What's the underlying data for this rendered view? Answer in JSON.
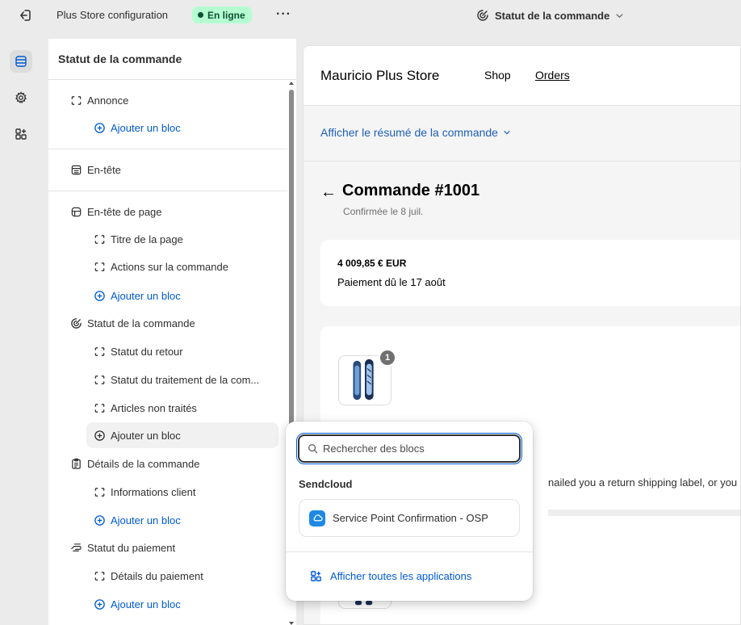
{
  "topbar": {
    "store_title": "Plus Store configuration",
    "status_label": "En ligne",
    "more_label": "···",
    "page_select_label": "Statut de la commande"
  },
  "sidebar": {
    "title": "Statut de la commande",
    "rows": [
      {
        "label": "Annonce",
        "icon": "bracket-icon"
      },
      {
        "label": "Ajouter un bloc",
        "icon": "plus-circle-icon"
      },
      {
        "label": "En-tête",
        "icon": "header-icon"
      },
      {
        "label": "En-tête de page",
        "icon": "page-header-icon"
      },
      {
        "label": "Titre de la page",
        "icon": "bracket-icon"
      },
      {
        "label": "Actions sur la commande",
        "icon": "bracket-icon"
      },
      {
        "label": "Ajouter un bloc",
        "icon": "plus-circle-icon"
      },
      {
        "label": "Statut de la commande",
        "icon": "order-status-icon"
      },
      {
        "label": "Statut du retour",
        "icon": "bracket-icon"
      },
      {
        "label": "Statut du traitement de la com...",
        "icon": "bracket-icon"
      },
      {
        "label": "Articles non traités",
        "icon": "bracket-icon"
      },
      {
        "label": "Ajouter un bloc",
        "icon": "plus-circle-icon"
      },
      {
        "label": "Détails de la commande",
        "icon": "clipboard-icon"
      },
      {
        "label": "Informations client",
        "icon": "bracket-icon"
      },
      {
        "label": "Ajouter un bloc",
        "icon": "plus-circle-icon"
      },
      {
        "label": "Statut du paiement",
        "icon": "payment-icon"
      },
      {
        "label": "Détails du paiement",
        "icon": "bracket-icon"
      },
      {
        "label": "Ajouter un bloc",
        "icon": "plus-circle-icon"
      }
    ]
  },
  "preview": {
    "store_name": "Mauricio Plus Store",
    "nav": {
      "shop": "Shop",
      "orders": "Orders"
    },
    "summary_link": "Afficher le résumé de la commande",
    "back_arrow": "←",
    "order_title": "Commande #1001",
    "order_subtitle": "Confirmée le 8 juil.",
    "amount": "4 009,85 € EUR",
    "due": "Paiement dû le 17 août",
    "item_quantity": "1",
    "partial_text": "nailed you a return shipping label, or you"
  },
  "popover": {
    "search_placeholder": "Rechercher des blocs",
    "group_title": "Sendcloud",
    "app_item": "Service Point Confirmation - OSP",
    "all_apps": "Afficher toutes les applications"
  }
}
